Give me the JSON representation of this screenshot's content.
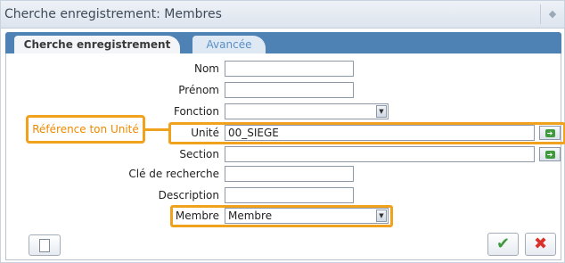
{
  "window": {
    "title": "Cherche enregistrement: Membres"
  },
  "tabs": [
    {
      "label": "Cherche enregistrement",
      "active": true
    },
    {
      "label": "Avancée",
      "active": false
    }
  ],
  "form": {
    "nom": {
      "label": "Nom",
      "value": ""
    },
    "prenom": {
      "label": "Prénom",
      "value": ""
    },
    "fonction": {
      "label": "Fonction",
      "value": ""
    },
    "unite": {
      "label": "Unité",
      "value": "00_SIEGE"
    },
    "section": {
      "label": "Section",
      "value": ""
    },
    "cle": {
      "label": "Clé de recherche",
      "value": ""
    },
    "description": {
      "label": "Description",
      "value": ""
    },
    "membre": {
      "label": "Membre",
      "value": "Membre"
    }
  },
  "callout": {
    "text": "Référence ton Unité"
  },
  "colors": {
    "highlight": "#f0a21e",
    "tabbar": "#4f82b4",
    "ok": "#3e9a3c",
    "cancel": "#d9322b"
  },
  "icons": {
    "new": "blank-page-icon",
    "ok": "checkmark-icon",
    "cancel": "x-cross-icon",
    "pick": "green-arrow-icon"
  }
}
